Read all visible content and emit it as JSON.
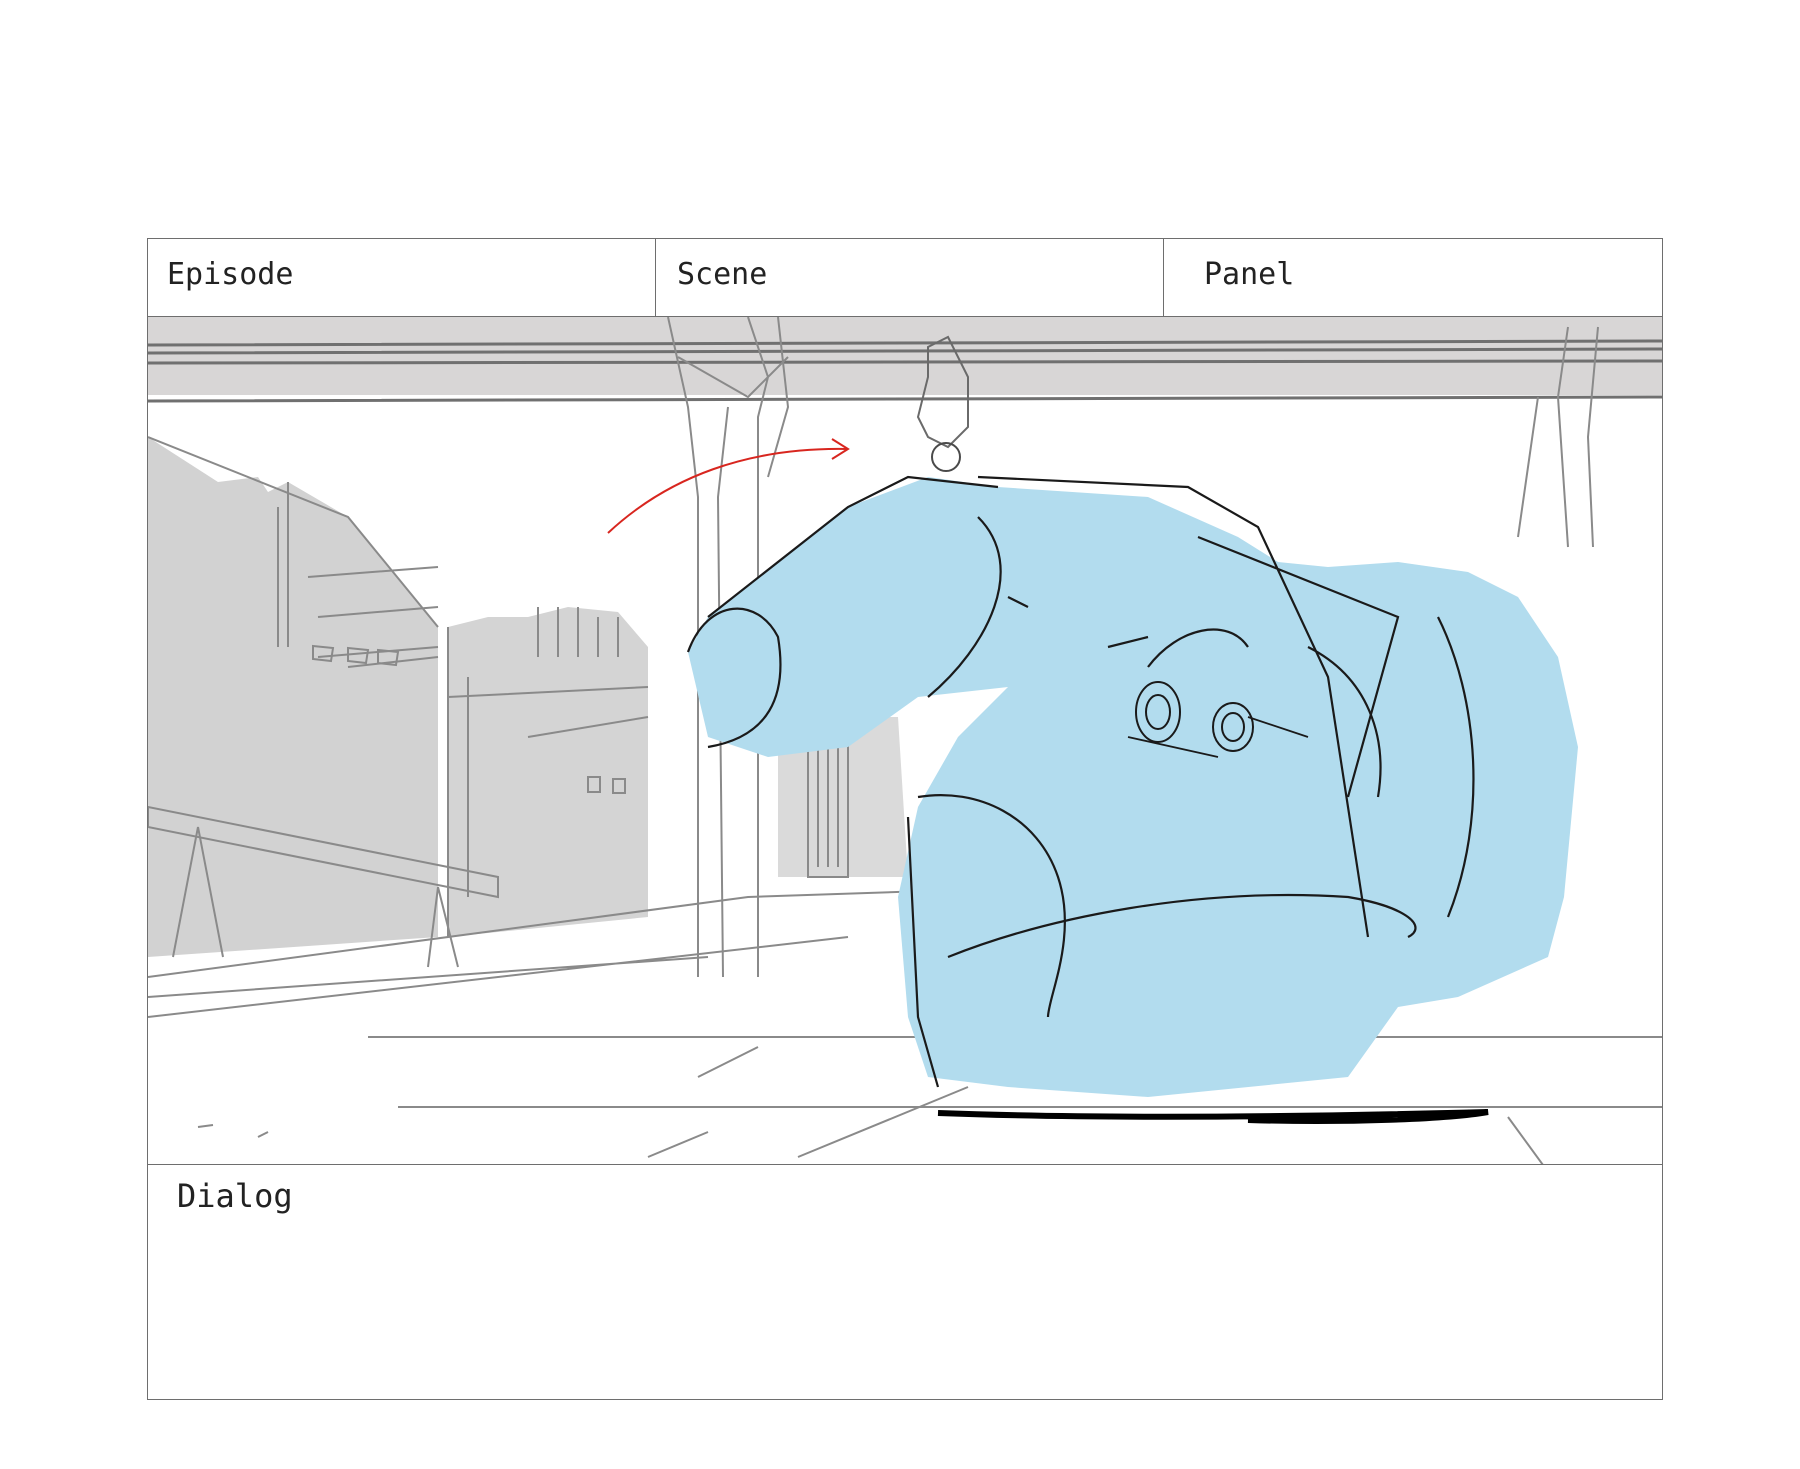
{
  "storyboard": {
    "episode_label": "Episode",
    "scene_label": "Scene",
    "panel_label": "Panel",
    "dialog_label": "Dialog"
  },
  "sketch": {
    "fill_color": "#b2dcee",
    "background_fill_color": "#d2d2d2",
    "motion_arrow_color": "#d8261f",
    "line_color": "#1a1a1a",
    "background_line_color": "#8a8a8a"
  }
}
